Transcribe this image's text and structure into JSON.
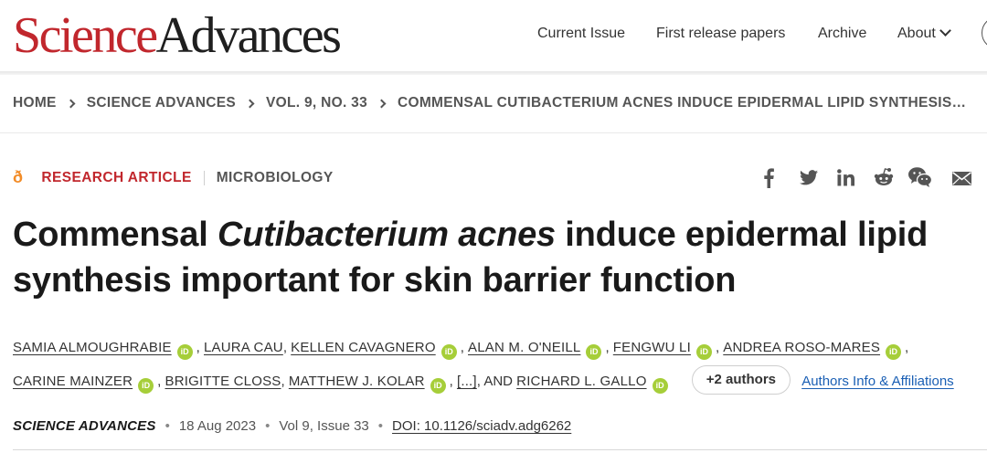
{
  "header": {
    "logo_science": "Science",
    "logo_advances": "Advances",
    "nav": [
      "Current Issue",
      "First release papers",
      "Archive",
      "About"
    ]
  },
  "breadcrumb": [
    "HOME",
    "SCIENCE ADVANCES",
    "VOL. 9, NO. 33",
    "COMMENSAL CUTIBACTERIUM ACNES INDUCE EPIDERMAL LIPID SYNTHESIS…"
  ],
  "article": {
    "access_icon": "open-access-icon",
    "type": "RESEARCH ARTICLE",
    "subject": "MICROBIOLOGY",
    "title_part1": "Commensal ",
    "title_italic": "Cutibacterium acnes",
    "title_part2": " induce epidermal lipid synthesis important for skin barrier function"
  },
  "share_icons": [
    "facebook-icon",
    "twitter-icon",
    "linkedin-icon",
    "reddit-icon",
    "wechat-icon",
    "email-icon"
  ],
  "authors": {
    "a1": "SAMIA ALMOUGHRABIE",
    "a2": "LAURA CAU",
    "a3": "KELLEN CAVAGNERO",
    "a4": "ALAN M. O'NEILL",
    "a5": "FENGWU LI",
    "a6": "ANDREA ROSO-MARES",
    "a7": "CARINE MAINZER",
    "a8": "BRIGITTE CLOSS",
    "a9": "MATTHEW J. KOLAR",
    "ellipsis": "[...]",
    "and": "AND",
    "a10": "RICHARD L. GALLO",
    "orcid_label": "iD",
    "more_button": "+2 authors",
    "affiliations_link": "Authors Info & Affiliations"
  },
  "publication": {
    "journal": "SCIENCE ADVANCES",
    "date": "18 Aug 2023",
    "volume_issue": "Vol 9, Issue 33",
    "doi": "DOI: 10.1126/sciadv.adg6262"
  },
  "colors": {
    "brand_red": "#c1272d",
    "open_access_orange": "#f28c28",
    "orcid_green": "#a6ce39",
    "link_blue": "#1a5fb4"
  }
}
